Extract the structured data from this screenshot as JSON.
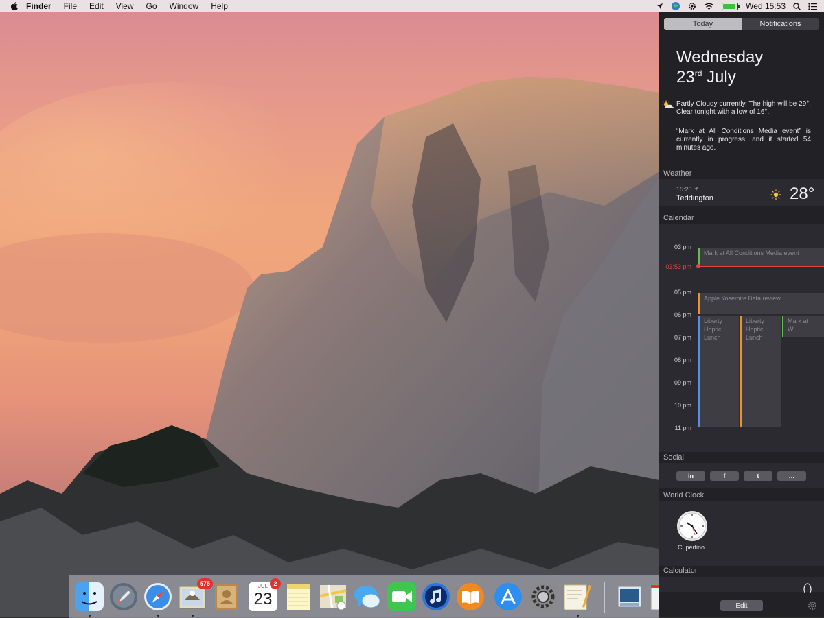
{
  "menubar": {
    "app_name": "Finder",
    "items": [
      "File",
      "Edit",
      "View",
      "Go",
      "Window",
      "Help"
    ],
    "clock": "Wed 15:53"
  },
  "notification_center": {
    "tabs": {
      "today": "Today",
      "notifications": "Notifications"
    },
    "date_line1": "Wednesday",
    "date_day": "23",
    "date_suffix": "rd",
    "date_month": "July",
    "summary_weather": "Partly Cloudy currently. The high will be 29°. Clear tonight with a low of 16°.",
    "summary_event": "“Mark at All Conditions Media event” is currently in progress, and it started 54 minutes ago.",
    "weather": {
      "title": "Weather",
      "time": "15:20",
      "city": "Teddington",
      "temp": "28°"
    },
    "calendar": {
      "title": "Calendar",
      "hours": [
        "03 pm",
        "05 pm",
        "06 pm",
        "07 pm",
        "08 pm",
        "09 pm",
        "10 pm",
        "11 pm"
      ],
      "now": "03:53 pm",
      "events": {
        "e1": "Mark at All Conditions Media event",
        "e2": "Apple Yosemite Beta review",
        "e3": "Liberty Hoptic Lunch",
        "e4": "Liberty Hoptic Lunch",
        "e5": "Mark at Wi..."
      },
      "colors": {
        "green": "#62c04a",
        "orange": "#f0902e",
        "blue": "#5b8de8",
        "now": "#e8443c"
      }
    },
    "social": {
      "title": "Social",
      "buttons": [
        "in",
        "f",
        "t",
        "…"
      ]
    },
    "world_clock": {
      "title": "World Clock",
      "city": "Cupertino"
    },
    "calculator": {
      "title": "Calculator"
    },
    "edit_label": "Edit"
  },
  "dock": {
    "mail_badge": "575",
    "calendar_month": "JUL",
    "calendar_day": "23",
    "calendar_badge": "2"
  }
}
